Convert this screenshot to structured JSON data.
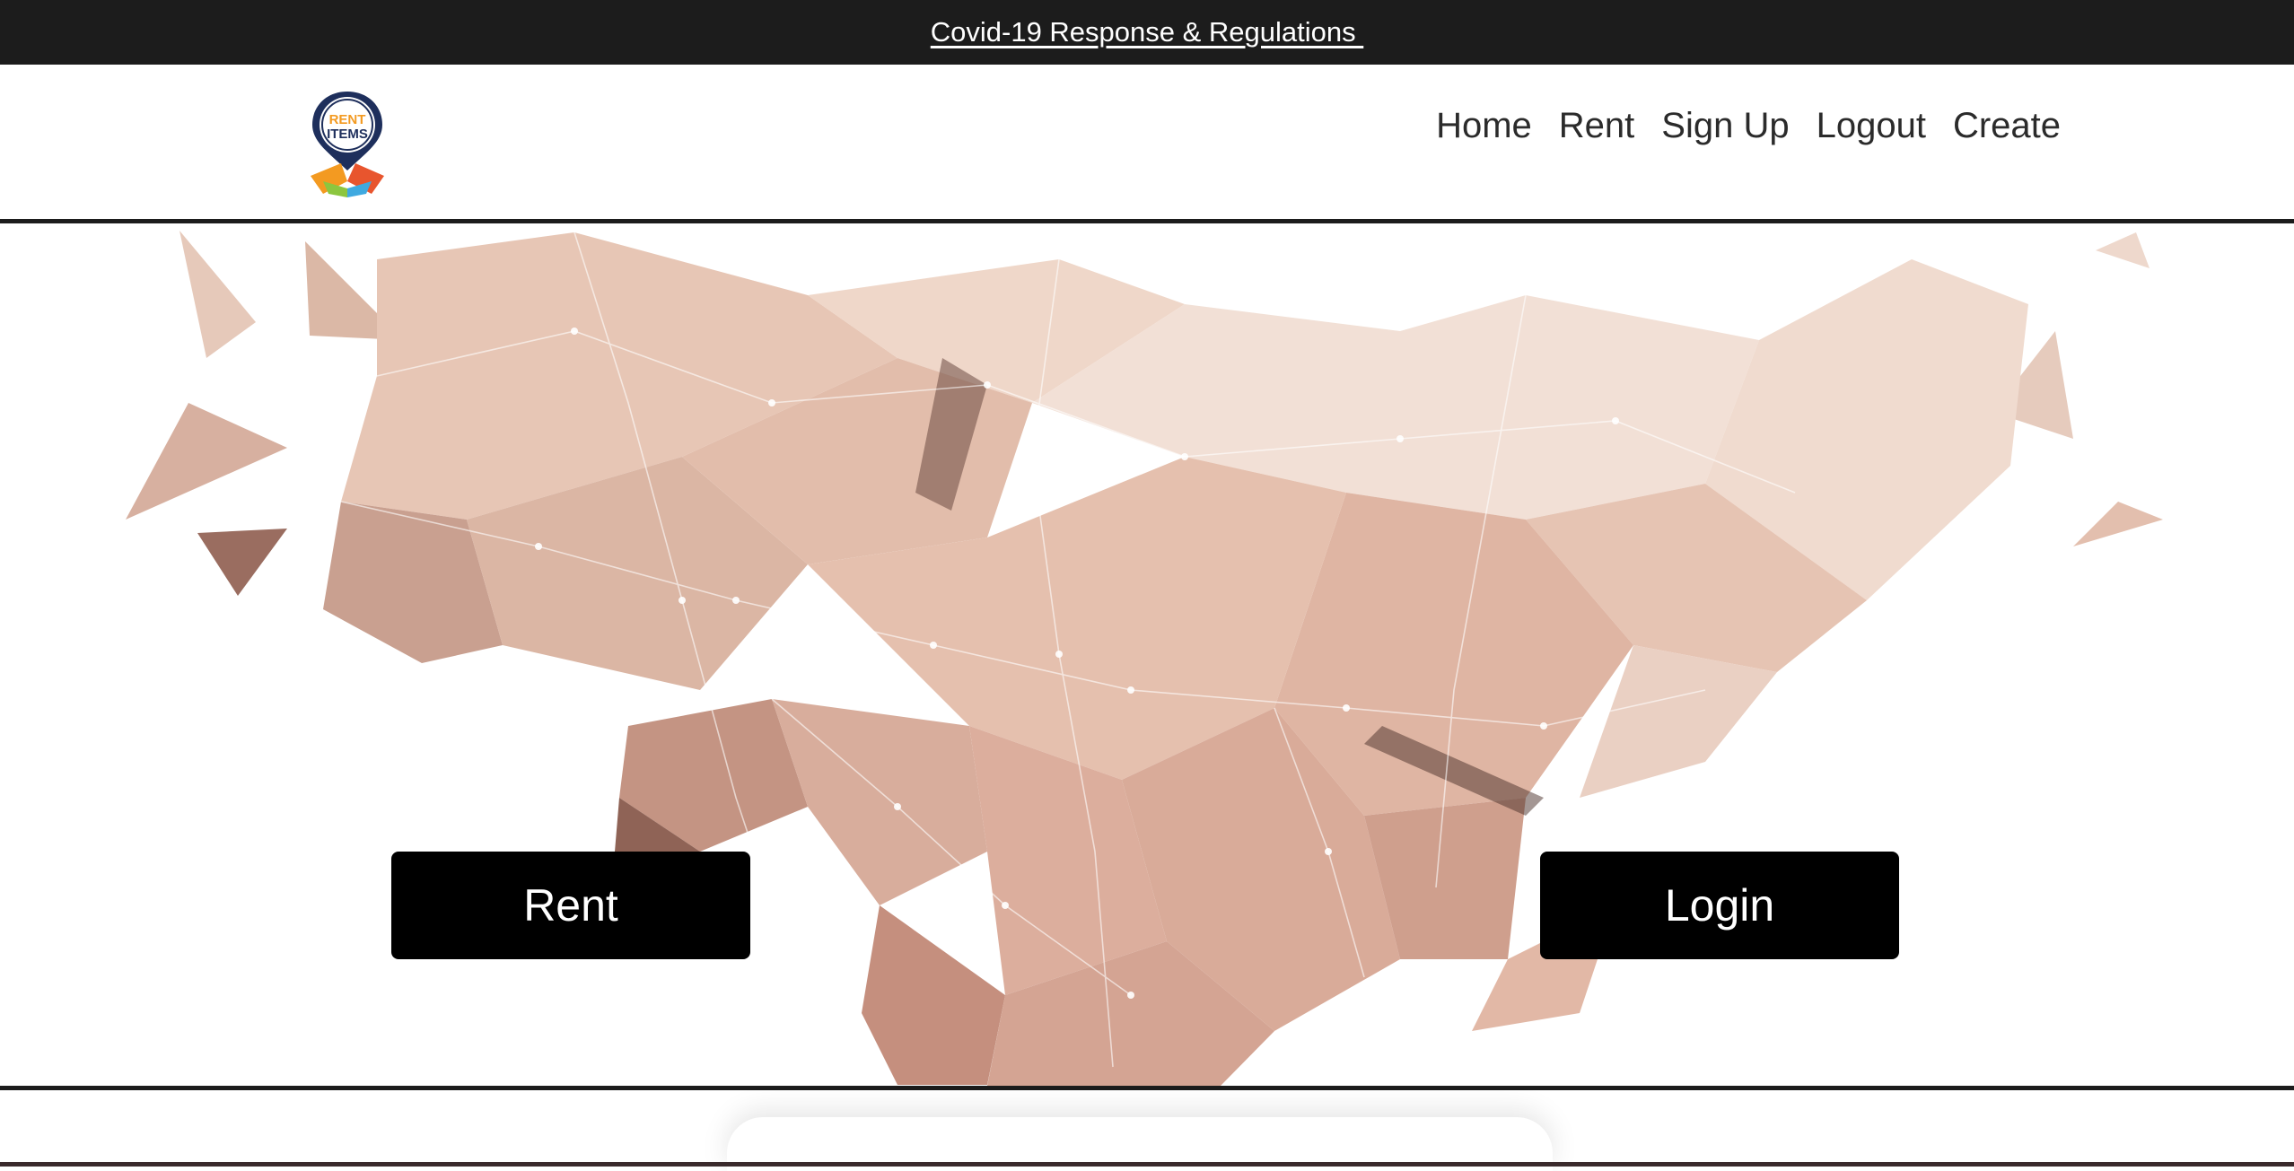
{
  "announcement": {
    "link_text": "Covid-19 Response & Regulations "
  },
  "logo": {
    "line1": "RENT",
    "line2": "ITEMS"
  },
  "nav": {
    "items": [
      {
        "label": "Home"
      },
      {
        "label": "Rent"
      },
      {
        "label": "Sign Up"
      },
      {
        "label": "Logout"
      },
      {
        "label": "Create"
      }
    ]
  },
  "hero": {
    "image_icon": "handshake-lowpoly-image",
    "rent_button": "Rent",
    "login_button": "Login"
  },
  "colors": {
    "topbar": "#1c1c1c",
    "button_bg": "#000000",
    "button_text": "#ffffff",
    "nav_text": "#2b2b2b",
    "logo_navy": "#1e2f5c",
    "logo_orange": "#f39a21"
  }
}
